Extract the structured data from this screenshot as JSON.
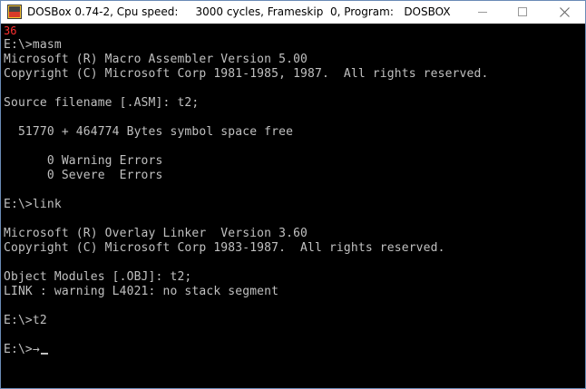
{
  "window": {
    "title": "DOSBox 0.74-2, Cpu speed:     3000 cycles, Frameskip  0, Program:   DOSBOX",
    "icon": "dosbox-app-icon",
    "controls": {
      "minimize_icon": "minimize-icon",
      "maximize_icon": "maximize-icon",
      "close_icon": "close-icon"
    }
  },
  "console": {
    "fps_counter": "36",
    "lines": [
      "E:\\>masm",
      "Microsoft (R) Macro Assembler Version 5.00",
      "Copyright (C) Microsoft Corp 1981-1985, 1987.  All rights reserved.",
      "",
      "Source filename [.ASM]: t2;",
      "",
      "  51770 + 464774 Bytes symbol space free",
      "",
      "      0 Warning Errors",
      "      0 Severe  Errors",
      "",
      "E:\\>link",
      "",
      "Microsoft (R) Overlay Linker  Version 3.60",
      "Copyright (C) Microsoft Corp 1983-1987.  All rights reserved.",
      "",
      "Object Modules [.OBJ]: t2;",
      "LINK : warning L4021: no stack segment",
      "",
      "E:\\>t2",
      "",
      "E:\\>→"
    ],
    "colors": {
      "background": "#000000",
      "text": "#c0c0c0",
      "fps": "#ff3030"
    }
  }
}
